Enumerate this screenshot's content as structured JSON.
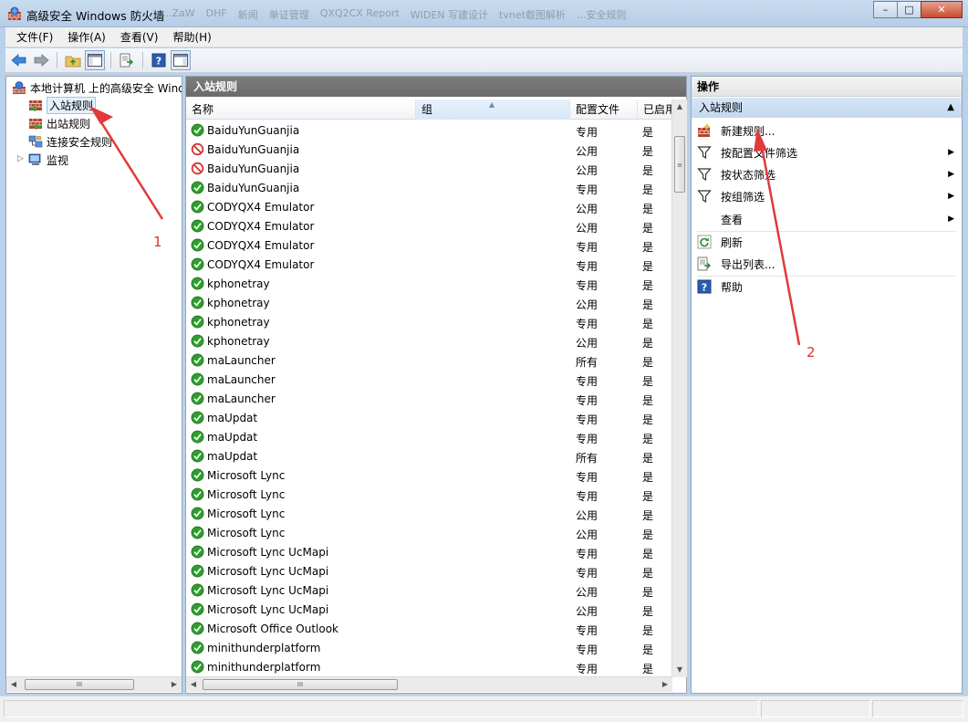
{
  "window": {
    "title": "高级安全 Windows 防火墙",
    "background_tabs": [
      "...ZaW",
      "DHF",
      "新闻",
      "单证管理",
      "QXQ2CX Report",
      "WIDEN 写建设计",
      "tvnet截图解析",
      "...安全规则"
    ],
    "controls": {
      "minimize": "–",
      "maximize": "□",
      "close": "✕"
    }
  },
  "menu": [
    "文件(F)",
    "操作(A)",
    "查看(V)",
    "帮助(H)"
  ],
  "toolbar": {
    "icons": [
      "back-icon",
      "forward-icon",
      "up-folder-icon",
      "show-tree-icon",
      "export-icon",
      "help-icon",
      "show-action-pane-icon"
    ]
  },
  "tree": {
    "root_label": "本地计算机 上的高级安全 Windows 防火墙",
    "items": [
      {
        "label": "入站规则",
        "icon": "inbound-rules-icon",
        "selected": true
      },
      {
        "label": "出站规则",
        "icon": "outbound-rules-icon",
        "selected": false
      },
      {
        "label": "连接安全规则",
        "icon": "connection-security-icon",
        "selected": false
      },
      {
        "label": "监视",
        "icon": "monitor-icon",
        "selected": false
      }
    ]
  },
  "center": {
    "header": "入站规则",
    "columns": [
      "名称",
      "组",
      "配置文件",
      "已启用"
    ],
    "rows": [
      {
        "name": "BaiduYunGuanjia",
        "status": "allow",
        "profile": "专用",
        "enabled": "是"
      },
      {
        "name": "BaiduYunGuanjia",
        "status": "block",
        "profile": "公用",
        "enabled": "是"
      },
      {
        "name": "BaiduYunGuanjia",
        "status": "block",
        "profile": "公用",
        "enabled": "是"
      },
      {
        "name": "BaiduYunGuanjia",
        "status": "allow",
        "profile": "专用",
        "enabled": "是"
      },
      {
        "name": "CODYQX4 Emulator",
        "status": "allow",
        "profile": "公用",
        "enabled": "是"
      },
      {
        "name": "CODYQX4 Emulator",
        "status": "allow",
        "profile": "公用",
        "enabled": "是"
      },
      {
        "name": "CODYQX4 Emulator",
        "status": "allow",
        "profile": "专用",
        "enabled": "是"
      },
      {
        "name": "CODYQX4 Emulator",
        "status": "allow",
        "profile": "专用",
        "enabled": "是"
      },
      {
        "name": "kphonetray",
        "status": "allow",
        "profile": "专用",
        "enabled": "是"
      },
      {
        "name": "kphonetray",
        "status": "allow",
        "profile": "公用",
        "enabled": "是"
      },
      {
        "name": "kphonetray",
        "status": "allow",
        "profile": "专用",
        "enabled": "是"
      },
      {
        "name": "kphonetray",
        "status": "allow",
        "profile": "公用",
        "enabled": "是"
      },
      {
        "name": "maLauncher",
        "status": "allow",
        "profile": "所有",
        "enabled": "是"
      },
      {
        "name": "maLauncher",
        "status": "allow",
        "profile": "专用",
        "enabled": "是"
      },
      {
        "name": "maLauncher",
        "status": "allow",
        "profile": "专用",
        "enabled": "是"
      },
      {
        "name": "maUpdat",
        "status": "allow",
        "profile": "专用",
        "enabled": "是"
      },
      {
        "name": "maUpdat",
        "status": "allow",
        "profile": "专用",
        "enabled": "是"
      },
      {
        "name": "maUpdat",
        "status": "allow",
        "profile": "所有",
        "enabled": "是"
      },
      {
        "name": "Microsoft Lync",
        "status": "allow",
        "profile": "专用",
        "enabled": "是"
      },
      {
        "name": "Microsoft Lync",
        "status": "allow",
        "profile": "专用",
        "enabled": "是"
      },
      {
        "name": "Microsoft Lync",
        "status": "allow",
        "profile": "公用",
        "enabled": "是"
      },
      {
        "name": "Microsoft Lync",
        "status": "allow",
        "profile": "公用",
        "enabled": "是"
      },
      {
        "name": "Microsoft Lync UcMapi",
        "status": "allow",
        "profile": "专用",
        "enabled": "是"
      },
      {
        "name": "Microsoft Lync UcMapi",
        "status": "allow",
        "profile": "专用",
        "enabled": "是"
      },
      {
        "name": "Microsoft Lync UcMapi",
        "status": "allow",
        "profile": "公用",
        "enabled": "是"
      },
      {
        "name": "Microsoft Lync UcMapi",
        "status": "allow",
        "profile": "公用",
        "enabled": "是"
      },
      {
        "name": "Microsoft Office Outlook",
        "status": "allow",
        "profile": "专用",
        "enabled": "是"
      },
      {
        "name": "minithunderplatform",
        "status": "allow",
        "profile": "专用",
        "enabled": "是"
      },
      {
        "name": "minithunderplatform",
        "status": "allow",
        "profile": "专用",
        "enabled": "是"
      }
    ]
  },
  "actions": {
    "header": "操作",
    "section": "入站规则",
    "items": [
      {
        "label": "新建规则...",
        "icon": "new-rule-icon",
        "submenu": false
      },
      {
        "label": "按配置文件筛选",
        "icon": "filter-icon",
        "submenu": true
      },
      {
        "label": "按状态筛选",
        "icon": "filter-icon",
        "submenu": true
      },
      {
        "label": "按组筛选",
        "icon": "filter-icon",
        "submenu": true
      },
      {
        "label": "查看",
        "icon": "",
        "submenu": true
      },
      {
        "label": "刷新",
        "icon": "refresh-icon",
        "submenu": false
      },
      {
        "label": "导出列表...",
        "icon": "export-list-icon",
        "submenu": false
      },
      {
        "label": "帮助",
        "icon": "help-icon",
        "submenu": false
      }
    ]
  },
  "annotations": {
    "label_1": "1",
    "label_2": "2",
    "color": "#e03a3a"
  },
  "colors": {
    "allow": "#2e9e2e",
    "block": "#d33b3b",
    "pane_header": "#707070",
    "section": "#c9dcf1"
  }
}
